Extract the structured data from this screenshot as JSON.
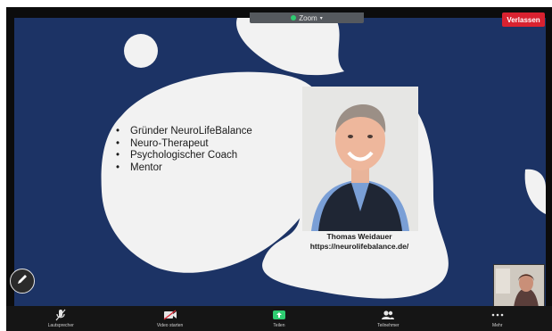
{
  "app": {
    "title": "Zoom",
    "leave_label": "Verlassen"
  },
  "slide": {
    "bullets": [
      "Gründer NeuroLifeBalance",
      "Neuro-Therapeut",
      "Psychologischer Coach",
      "Mentor"
    ],
    "caption_name": "Thomas Weidauer",
    "caption_url": "https://neurolifebalance.de/"
  },
  "toolbar": {
    "items": [
      {
        "label": "Lautsprecher",
        "icon": "microphone-icon"
      },
      {
        "label": "Video starten",
        "icon": "video-camera-icon"
      },
      {
        "label": "Teilen",
        "icon": "share-screen-icon"
      },
      {
        "label": "Teilnehmer",
        "icon": "participants-icon"
      },
      {
        "label": "Mehr",
        "icon": "more-icon"
      }
    ]
  },
  "colors": {
    "slide_background": "#1c3365",
    "blob": "#f2f2f2",
    "leave_button": "#d92230",
    "share_green": "#2ecc71"
  }
}
